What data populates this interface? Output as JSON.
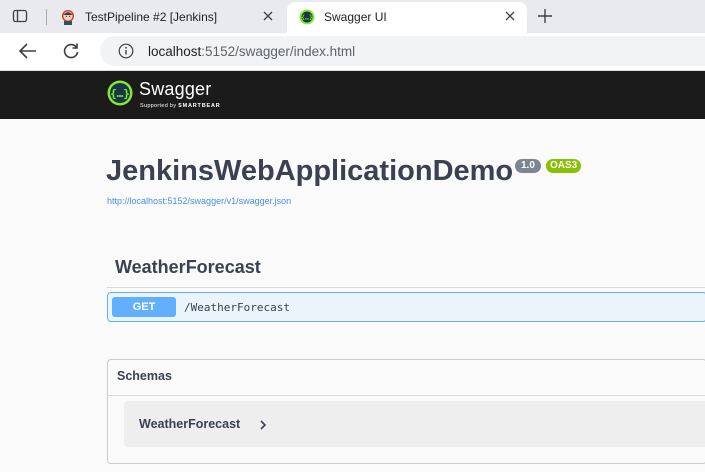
{
  "browser": {
    "tabs": [
      {
        "title": "TestPipeline #2 [Jenkins]",
        "icon": "jenkins-favicon",
        "active": false
      },
      {
        "title": "Swagger UI",
        "icon": "swagger-favicon",
        "active": true
      }
    ],
    "address": {
      "host": "localhost",
      "rest": ":5152/swagger/index.html"
    }
  },
  "swagger_header": {
    "brand": "Swagger",
    "tagline_prefix": "Supported by",
    "tagline_company": "SMARTBEAR",
    "accent": "#85ea2d"
  },
  "info": {
    "title": "JenkinsWebApplicationDemo",
    "version": "1.0",
    "oas_badge": "OAS3",
    "spec_url": "http://localhost:5152/swagger/v1/swagger.json"
  },
  "tag": {
    "name": "WeatherForecast",
    "operations": [
      {
        "method": "GET",
        "path": "/WeatherForecast",
        "color": "#61affe"
      }
    ]
  },
  "schemas": {
    "title": "Schemas",
    "models": [
      {
        "name": "WeatherForecast",
        "expanded": false
      }
    ]
  }
}
